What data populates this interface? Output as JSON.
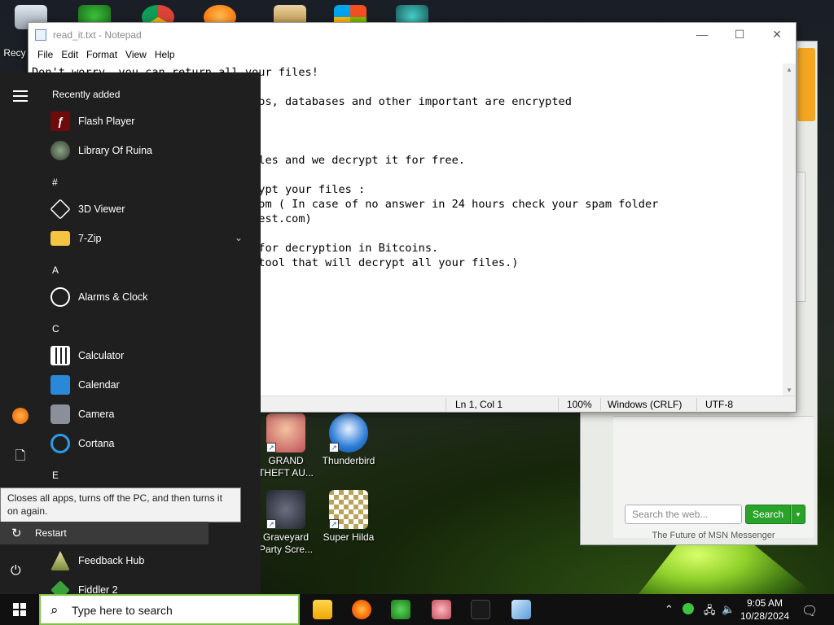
{
  "colors": {
    "taskbar": "#101010",
    "start_menu": "#1f1f1f",
    "search_border": "#7dc242",
    "msn_search": "#2aa32a"
  },
  "desktop": {
    "icons": [
      {
        "label": "Recy",
        "icon": "recycle-bin-icon"
      },
      {
        "label": "GRAND THEFT AU...",
        "icon": "game-shortcut-icon"
      },
      {
        "label": "Thunderbird",
        "icon": "thunderbird-icon"
      },
      {
        "label": "Graveyard Party Scre...",
        "icon": "game-shortcut-icon"
      },
      {
        "label": "Super Hilda",
        "icon": "game-shortcut-icon"
      }
    ]
  },
  "msn": {
    "search_placeholder": "Search the web...",
    "search_button": "Search",
    "dropdown_glyph": "▾",
    "footer": "The Future of MSN Messenger"
  },
  "notepad": {
    "title": "read_it.txt - Notepad",
    "window_buttons": {
      "minimize": "—",
      "maximize": "☐",
      "close": "✕"
    },
    "menu": [
      "File",
      "Edit",
      "Format",
      "View",
      "Help"
    ],
    "text": "Don't worry, you can return all your files!\n\n                                  os, databases and other important are encrypted\n\n\n\n                                  les and we decrypt it for free.\n\n                                  ypt your files :\n                                  om ( In case of no answer in 24 hours check your spam folder\n                                  est.com)\n\n                                  for decryption in Bitcoins.\n                                  tool that will decrypt all your files.)",
    "status": {
      "position": "Ln 1, Col 1",
      "zoom": "100%",
      "line_ending": "Windows (CRLF)",
      "encoding": "UTF-8"
    }
  },
  "start_menu": {
    "recently_added": "Recently added",
    "sections": {
      "hash": "#",
      "a": "A",
      "c": "C",
      "e": "E"
    },
    "apps": {
      "flash": "Flash Player",
      "ruina": "Library Of Ruina",
      "viewer3d": "3D Viewer",
      "zip": "7-Zip",
      "alarms": "Alarms & Clock",
      "calculator": "Calculator",
      "calendar": "Calendar",
      "camera": "Camera",
      "cortana": "Cortana",
      "feedback": "Feedback Hub",
      "fiddler": "Fiddler 2"
    },
    "chevron": "⌄",
    "tooltip": "Closes all apps, turns off the PC, and then turns it on again.",
    "restart": "Restart"
  },
  "taskbar": {
    "search_placeholder": "Type here to search",
    "apps": [
      "file-explorer-icon",
      "firefox-icon",
      "msn-messenger-icon",
      "game-icon",
      "chaos-app-icon",
      "notepad-icon"
    ],
    "time": "9:05 AM",
    "date": "10/28/2024"
  }
}
